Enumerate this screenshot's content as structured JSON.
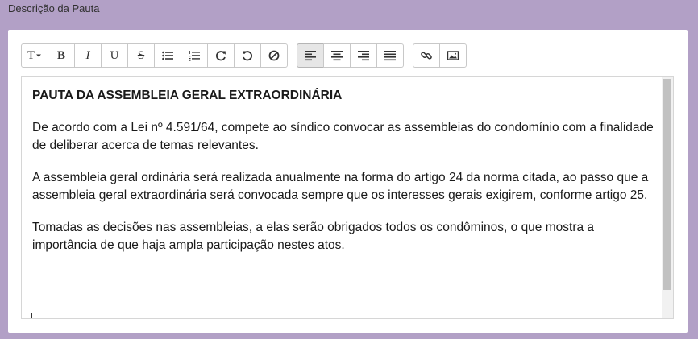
{
  "field": {
    "label": "Descrição da Pauta"
  },
  "toolbar": {
    "groups": [
      [
        {
          "name": "text-style-dropdown",
          "label": "T",
          "icon": "text-format-icon"
        },
        {
          "name": "bold-button",
          "label": "B",
          "icon": "bold-icon"
        },
        {
          "name": "italic-button",
          "label": "I",
          "icon": "italic-icon"
        },
        {
          "name": "underline-button",
          "label": "U",
          "icon": "underline-icon"
        },
        {
          "name": "strikethrough-button",
          "label": "S",
          "icon": "strikethrough-icon"
        },
        {
          "name": "bullet-list-button",
          "icon": "bullet-list-icon"
        },
        {
          "name": "numbered-list-button",
          "icon": "numbered-list-icon"
        },
        {
          "name": "redo-button",
          "icon": "redo-icon"
        },
        {
          "name": "undo-button",
          "icon": "undo-icon"
        },
        {
          "name": "clear-format-button",
          "icon": "clear-format-icon"
        }
      ],
      [
        {
          "name": "align-left-button",
          "icon": "align-left-icon",
          "active": true
        },
        {
          "name": "align-center-button",
          "icon": "align-center-icon"
        },
        {
          "name": "align-right-button",
          "icon": "align-right-icon"
        },
        {
          "name": "align-justify-button",
          "icon": "align-justify-icon"
        }
      ],
      [
        {
          "name": "link-button",
          "icon": "link-icon"
        },
        {
          "name": "image-button",
          "icon": "image-icon"
        }
      ]
    ]
  },
  "editor": {
    "heading": "PAUTA DA ASSEMBLEIA GERAL EXTRAORDINÁRIA",
    "paragraphs": [
      "De acordo com a Lei nº 4.591/64, compete ao síndico convocar as assembleias do condomínio com a finalidade de deliberar acerca de temas relevantes.",
      "A assembleia geral ordinária será realizada anualmente na forma do artigo 24 da norma citada, ao passo que a assembleia geral extraordinária será convocada sempre que os interesses gerais exigirem, conforme artigo 25.",
      "Tomadas as decisões nas assembleias, a elas serão obrigados todos os condôminos, o que mostra a importância de que haja ampla participação nestes atos."
    ]
  }
}
